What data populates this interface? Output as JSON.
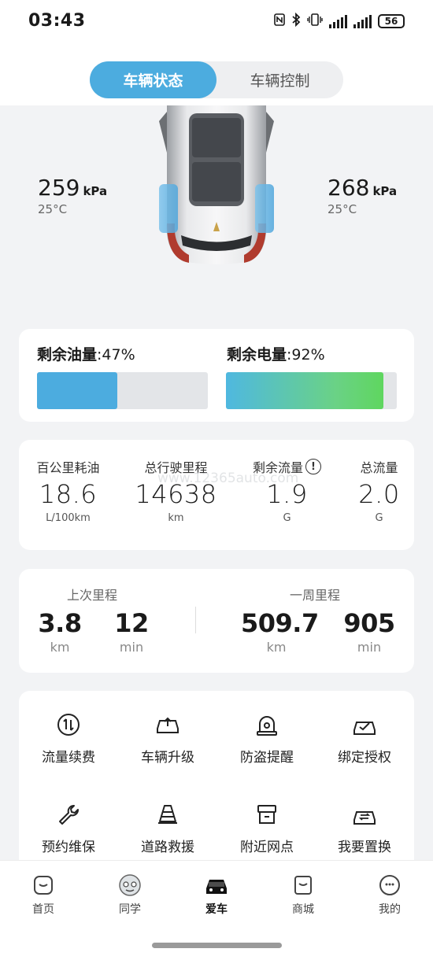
{
  "status_bar": {
    "time": "03:43",
    "battery": "56",
    "icons": [
      "nfc-icon",
      "bluetooth-icon",
      "vibrate-icon",
      "signal-icon",
      "signal-icon",
      "battery-icon"
    ]
  },
  "tabs": [
    {
      "label": "车辆状态",
      "active": true
    },
    {
      "label": "车辆控制",
      "active": false
    }
  ],
  "tires": {
    "left": {
      "pressure": "259",
      "unit": "kPa",
      "temp": "25°C"
    },
    "right": {
      "pressure": "268",
      "unit": "kPa",
      "temp": "25°C"
    }
  },
  "levels": {
    "fuel": {
      "label": "剩余油量",
      "value": "47%",
      "fraction": 0.47,
      "color": "#4cacdf"
    },
    "electric": {
      "label": "剩余电量",
      "value": "92%",
      "fraction": 0.92,
      "color": "#5fd65f"
    }
  },
  "stats": [
    {
      "label": "百公里耗油",
      "value": "18.6",
      "unit": "L/100km"
    },
    {
      "label": "总行驶里程",
      "value": "14638",
      "unit": "km"
    },
    {
      "label": "剩余流量",
      "value": "1.9",
      "unit": "G",
      "icon": "info-icon"
    },
    {
      "label": "总流量",
      "value": "2.0",
      "unit": "G"
    }
  ],
  "trips": {
    "last": {
      "title": "上次里程",
      "distance": "3.8",
      "distance_unit": "km",
      "time": "12",
      "time_unit": "min"
    },
    "week": {
      "title": "一周里程",
      "distance": "509.7",
      "distance_unit": "km",
      "time": "905",
      "time_unit": "min"
    }
  },
  "services": [
    {
      "label": "流量续费",
      "icon": "data-renew-icon"
    },
    {
      "label": "车辆升级",
      "icon": "car-upgrade-icon"
    },
    {
      "label": "防盗提醒",
      "icon": "anti-theft-alarm-icon"
    },
    {
      "label": "绑定授权",
      "icon": "bind-authorize-icon"
    },
    {
      "label": "预约维保",
      "icon": "wrench-icon"
    },
    {
      "label": "道路救援",
      "icon": "traffic-cone-icon"
    },
    {
      "label": "附近网点",
      "icon": "store-icon"
    },
    {
      "label": "我要置换",
      "icon": "car-exchange-icon"
    }
  ],
  "nav": [
    {
      "label": "首页",
      "icon": "home-icon",
      "active": false
    },
    {
      "label": "同学",
      "icon": "community-icon",
      "active": false
    },
    {
      "label": "爱车",
      "icon": "car-icon",
      "active": true
    },
    {
      "label": "商城",
      "icon": "shop-icon",
      "active": false
    },
    {
      "label": "我的",
      "icon": "profile-icon",
      "active": false
    }
  ],
  "watermark": "www.12365auto.com"
}
